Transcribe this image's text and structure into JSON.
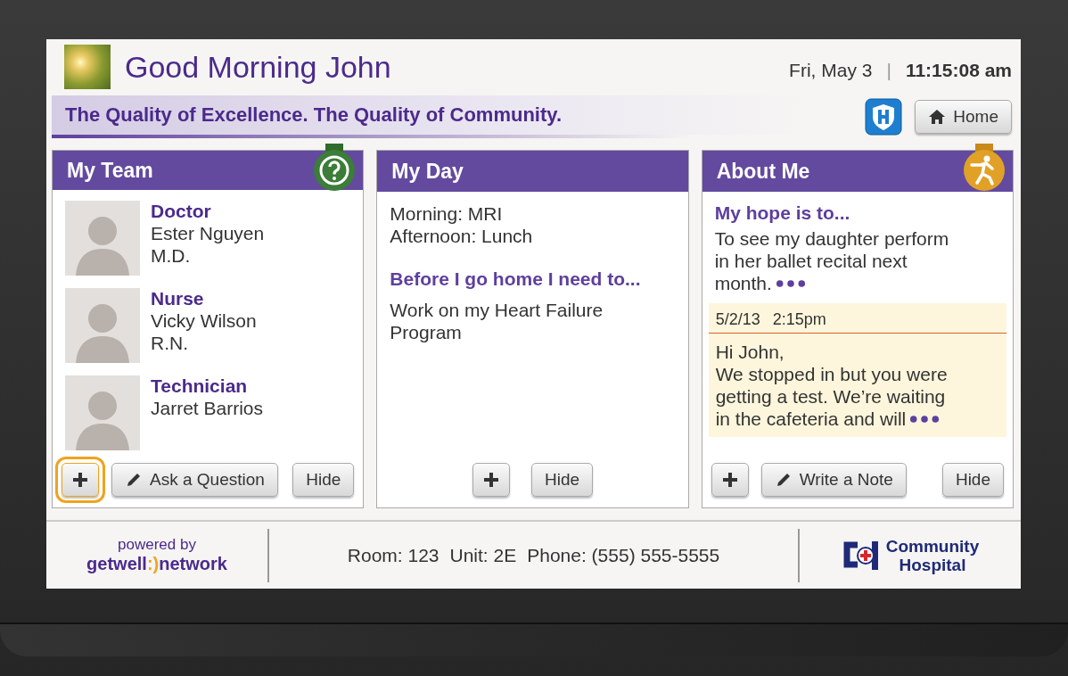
{
  "header": {
    "greeting": "Good Morning John",
    "date": "Fri, May 3",
    "separator": "|",
    "time": "11:15:08 am"
  },
  "banner": {
    "tagline": "The Quality of Excellence. The Quality of Community.",
    "home_label": "Home"
  },
  "panels": [
    {
      "kind": "team",
      "title": "My Team",
      "members": [
        {
          "role": "Doctor",
          "name": "Ester Nguyen",
          "credential": "M.D."
        },
        {
          "role": "Nurse",
          "name": "Vicky Wilson",
          "credential": "R.N."
        },
        {
          "role": "Technician",
          "name": "Jarret Barrios"
        }
      ],
      "buttons": [
        {
          "kind": "add",
          "focused": true
        },
        {
          "kind": "write",
          "label": "Ask a Question",
          "focused": false
        },
        {
          "kind": "text",
          "label": "Hide",
          "focused": false
        }
      ]
    },
    {
      "kind": "day",
      "title": "My Day",
      "schedule": [
        "Morning: MRI",
        "Afternoon: Lunch"
      ],
      "goal_heading": "Before I go home I need to...",
      "goal": "Work on my Heart Failure Program",
      "buttons": [
        {
          "kind": "add",
          "focused": false
        },
        {
          "kind": "text",
          "label": "Hide",
          "focused": false
        }
      ]
    },
    {
      "kind": "about",
      "title": "About Me",
      "hope_heading": "My hope is to...",
      "hope_lines": [
        "To see my daughter perform",
        "in her ballet recital next",
        "month."
      ],
      "note": {
        "date": "5/2/13",
        "time": "2:15pm",
        "lines": [
          "Hi John,",
          "We stopped in but you were",
          "getting a test. We’re waiting",
          "in the cafeteria and will"
        ]
      },
      "buttons": [
        {
          "kind": "add",
          "focused": false
        },
        {
          "kind": "write",
          "label": "Write a Note",
          "focused": false
        },
        {
          "kind": "text",
          "label": "Hide",
          "focused": false
        }
      ]
    }
  ],
  "footer": {
    "powered_by": "powered by",
    "brand": [
      {
        "text": "getwell",
        "accent": false
      },
      {
        "text": ":)",
        "accent": true
      },
      {
        "text": "network",
        "accent": false
      }
    ],
    "room": "Room: 123",
    "unit": "Unit: 2E",
    "phone": "Phone: (555) 555-5555",
    "hospital": [
      "Community",
      "Hospital"
    ]
  }
}
